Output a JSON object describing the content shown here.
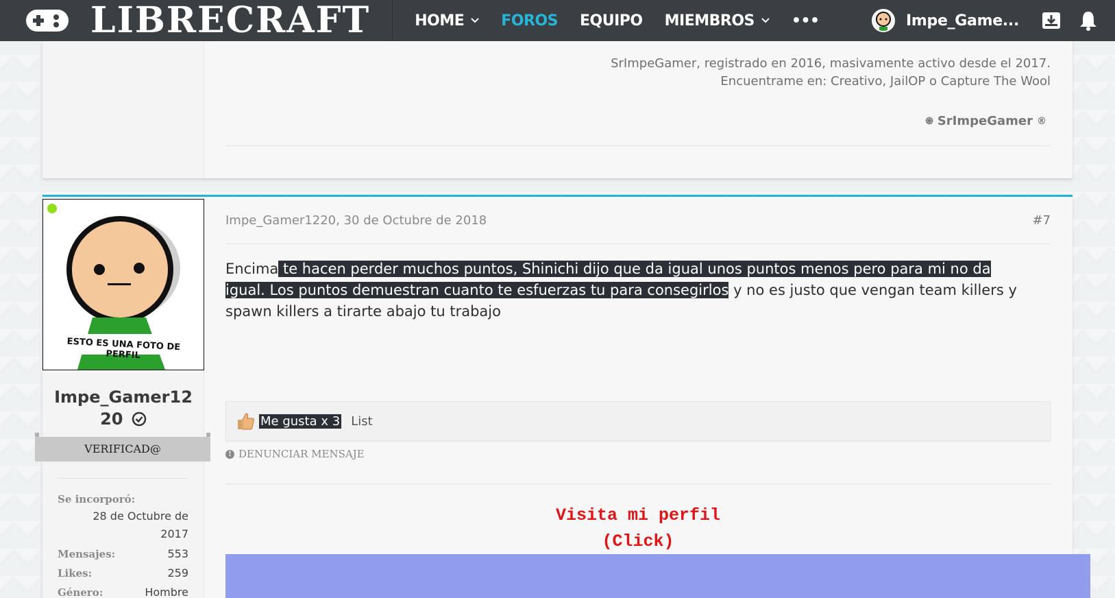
{
  "navbar": {
    "logo_text": "LIBRECRAFT",
    "items": [
      {
        "label": "HOME",
        "has_dropdown": true,
        "active": false
      },
      {
        "label": "FOROS",
        "has_dropdown": false,
        "active": true
      },
      {
        "label": "EQUIPO",
        "has_dropdown": false,
        "active": false
      },
      {
        "label": "MIEMBROS",
        "has_dropdown": true,
        "active": false
      },
      {
        "label": "•••",
        "has_dropdown": false,
        "active": false
      }
    ],
    "username": "Impe_Game...",
    "icons": [
      "gamepad-icon",
      "inbox-icon",
      "bell-icon"
    ],
    "active_color": "#27b4d9"
  },
  "previous_post": {
    "signature_lines": [
      "SrImpeGamer, registrado en 2016, masivamente activo desde el 2017.",
      "Encuentrame en: Creativo, JailOP o Capture The Wool"
    ],
    "signature_name": "SrImpeGamer"
  },
  "post": {
    "avatar_caption": "ESTO ES UNA FOTO DE PERFIL",
    "username_line1": "Impe_Gamer12",
    "username_line2": "20",
    "badge": "VERIFICAD@",
    "info": [
      {
        "label": "Se incorporó:",
        "value_line1": "28 de Octubre de",
        "value_line2": "2017"
      },
      {
        "label": "Mensajes:",
        "value": "553"
      },
      {
        "label": "Likes:",
        "value": "259"
      },
      {
        "label": "Género:",
        "value": "Hombre"
      }
    ],
    "meta": "Impe_Gamer1220, 30 de Octubre de 2018",
    "number": "#7",
    "body": {
      "part1": "Encima",
      "hl1": " te hacen perder muchos puntos",
      "hl2": ", Shinichi dijo que da igual unos puntos menos pero para mi no da igual. Los puntos demuestran cuanto te esfuerzas tu para consegirlos",
      "part2": " y no es justo que vengan team killers y spawn killers a tirarte abajo tu trabajo"
    },
    "likes_label": "Me gusta x 3",
    "likes_list": "List",
    "report": "DENUNCIAR MENSAJE",
    "signature_link_line1": "Visita mi perfil",
    "signature_link_line2": "(Click)"
  },
  "colors": {
    "navbar_bg": "#3a3f44",
    "accent": "#1fb5d8",
    "highlight_bg": "#2a3036",
    "signature_link": "#e11515",
    "banner": "#8f9dec",
    "online": "#8ee11a"
  }
}
